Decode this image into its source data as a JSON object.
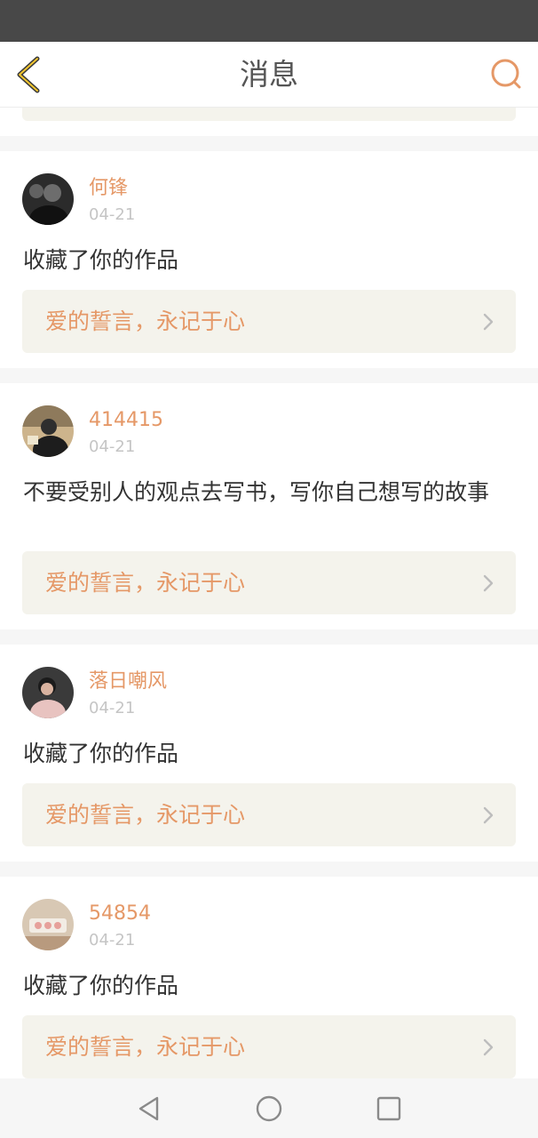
{
  "header": {
    "title": "消息"
  },
  "messages": [
    {
      "username": "何锋",
      "date": "04-21",
      "text": "收藏了你的作品",
      "work_title": "爱的誓言，永记于心",
      "avatar": "dark-portrait"
    },
    {
      "username": "414415",
      "date": "04-21",
      "text": "不要受别人的观点去写书，写你自己想写的故事",
      "work_title": "爱的誓言，永记于心",
      "avatar": "hooded-figure"
    },
    {
      "username": "落日嘲风",
      "date": "04-21",
      "text": "收藏了你的作品",
      "work_title": "爱的誓言，永记于心",
      "avatar": "person-photo"
    },
    {
      "username": "54854",
      "date": "04-21",
      "text": "收藏了你的作品",
      "work_title": "爱的誓言，永记于心",
      "avatar": "food-photo"
    }
  ],
  "colors": {
    "accent": "#e59867",
    "card_link_bg": "#f4f3ec",
    "status_bar": "#484848"
  },
  "icons": {
    "back": "chevron-left-icon",
    "search": "search-icon",
    "link": "chevron-right-icon"
  },
  "nav": {
    "back": "triangle-back-icon",
    "home": "circle-home-icon",
    "recent": "square-recent-icon"
  }
}
